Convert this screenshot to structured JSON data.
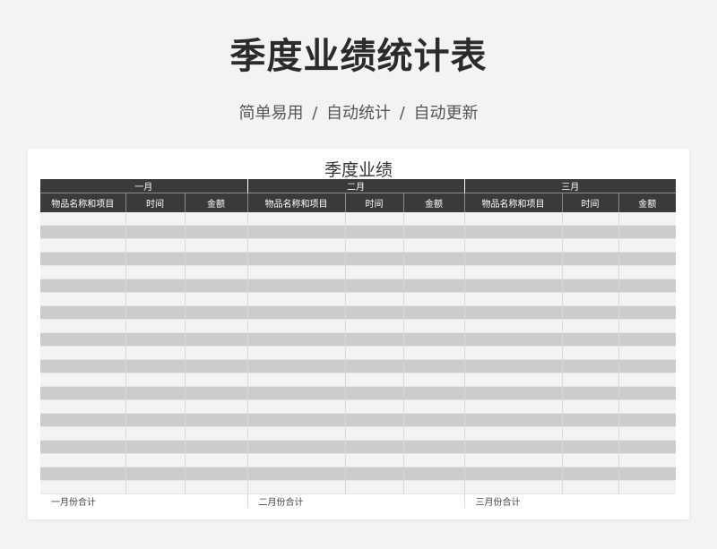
{
  "header": {
    "title": "季度业绩统计表",
    "subtitle": "简单易用 / 自动统计 / 自动更新"
  },
  "sheet": {
    "title": "季度业绩",
    "months": [
      "一月",
      "二月",
      "三月"
    ],
    "columns": [
      "物品名称和项目",
      "时间",
      "金额"
    ],
    "totals": [
      "一月份合计",
      "二月份合计",
      "三月份合计"
    ],
    "row_count": 21
  },
  "colors": {
    "header_bg": "#3a3a3a",
    "row_light": "#f3f3f3",
    "row_dark": "#cccccc",
    "page_bg": "#f2f3f5"
  }
}
